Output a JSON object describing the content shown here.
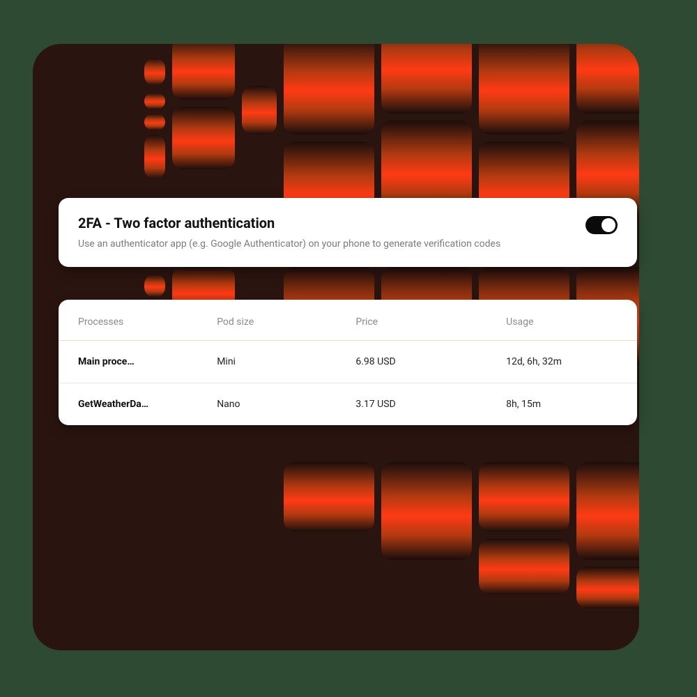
{
  "twofa": {
    "title": "2FA - Two factor authentication",
    "description": "Use an authenticator app (e.g. Google Authenticator) on your phone to generate verification codes",
    "enabled": true
  },
  "table": {
    "headers": {
      "processes": "Processes",
      "pod_size": "Pod size",
      "price": "Price",
      "usage": "Usage"
    },
    "rows": [
      {
        "process": "Main proce…",
        "pod_size": "Mini",
        "price": "6.98 USD",
        "usage": "12d, 6h, 32m"
      },
      {
        "process": "GetWeatherDa…",
        "pod_size": "Nano",
        "price": "3.17 USD",
        "usage": "8h, 15m"
      }
    ]
  }
}
